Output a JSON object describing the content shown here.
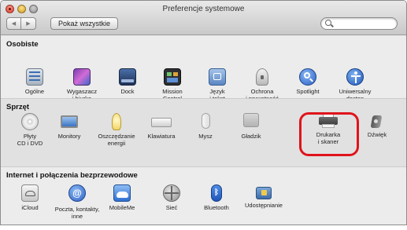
{
  "window": {
    "title": "Preferencje systemowe",
    "show_all": "Pokaż wszystkie",
    "back_glyph": "◀",
    "forward_glyph": "▶",
    "search_value": ""
  },
  "sections": {
    "personal": {
      "title": "Osobiste",
      "items": [
        {
          "line1": "Ogólne",
          "line2": "",
          "icon": "general-icon"
        },
        {
          "line1": "Wygaszacz",
          "line2": "i biurko",
          "icon": "desktop-screensaver-icon"
        },
        {
          "line1": "Dock",
          "line2": "",
          "icon": "dock-icon"
        },
        {
          "line1": "Mission",
          "line2": "Control",
          "icon": "mission-control-icon"
        },
        {
          "line1": "Język",
          "line2": "i tekst",
          "icon": "language-text-icon"
        },
        {
          "line1": "Ochrona",
          "line2": "i prywatność",
          "icon": "security-privacy-icon"
        },
        {
          "line1": "Spotlight",
          "line2": "",
          "icon": "spotlight-icon"
        },
        {
          "line1": "Uniwersalny",
          "line2": "dostęp",
          "icon": "universal-access-icon"
        }
      ]
    },
    "hardware": {
      "title": "Sprzęt",
      "items": [
        {
          "line1": "Płyty",
          "line2": "CD i DVD",
          "icon": "cd-dvd-icon"
        },
        {
          "line1": "Monitory",
          "line2": "",
          "icon": "displays-icon"
        },
        {
          "line1": "Oszczędzanie",
          "line2": "energii",
          "icon": "energy-saver-icon"
        },
        {
          "line1": "Klawiatura",
          "line2": "",
          "icon": "keyboard-icon"
        },
        {
          "line1": "Mysz",
          "line2": "",
          "icon": "mouse-icon"
        },
        {
          "line1": "Gładzik",
          "line2": "",
          "icon": "trackpad-icon"
        },
        {
          "line1": "Drukarka",
          "line2": "i skaner",
          "icon": "printer-scanner-icon"
        },
        {
          "line1": "Dźwięk",
          "line2": "",
          "icon": "sound-icon"
        }
      ]
    },
    "internet": {
      "title": "Internet i połączenia bezprzewodowe",
      "items": [
        {
          "line1": "iCloud",
          "line2": "",
          "icon": "icloud-icon"
        },
        {
          "line1": "Poczta, kontakty,",
          "line2": "inne",
          "icon": "mail-contacts-icon"
        },
        {
          "line1": "MobileMe",
          "line2": "",
          "icon": "mobileme-icon"
        },
        {
          "line1": "Sieć",
          "line2": "",
          "icon": "network-icon"
        },
        {
          "line1": "Bluetooth",
          "line2": "",
          "icon": "bluetooth-icon"
        },
        {
          "line1": "Udostępnianie",
          "line2": "",
          "icon": "sharing-icon"
        }
      ]
    }
  },
  "colors": {
    "highlight": "#e0141c"
  }
}
